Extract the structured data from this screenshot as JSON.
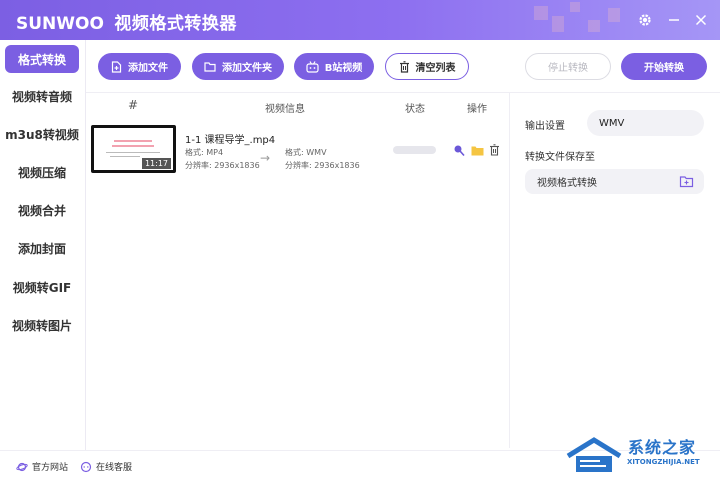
{
  "app": {
    "brand": "SUNWOO",
    "title": "视频格式转换器"
  },
  "colors": {
    "accent": "#7b5fe2",
    "sidebar_active_bg": "#7b5fe2",
    "watermark_blue": "#2a74c9"
  },
  "titlebar_icons": [
    "gear-icon",
    "minimize-icon",
    "close-icon"
  ],
  "sidebar": {
    "active_index": 0,
    "items": [
      {
        "label": "格式转换"
      },
      {
        "label": "视频转音频"
      },
      {
        "label": "m3u8转视频"
      },
      {
        "label": "视频压缩"
      },
      {
        "label": "视频合并"
      },
      {
        "label": "添加封面"
      },
      {
        "label": "视频转GIF"
      },
      {
        "label": "视频转图片"
      }
    ]
  },
  "toolbar": {
    "add_file": "添加文件",
    "add_folder": "添加文件夹",
    "bilibili": "B站视频",
    "clear_list": "清空列表",
    "stop": "停止转换",
    "start": "开始转换"
  },
  "table": {
    "headers": {
      "index": "#",
      "info": "视频信息",
      "status": "状态",
      "action": "操作"
    },
    "rows": [
      {
        "filename": "1-1 课程导学_.mp4",
        "duration": "11:17",
        "source_format_label": "格式:",
        "source_format": "MP4",
        "source_resolution_label": "分辨率:",
        "source_resolution": "2936x1836",
        "target_format_label": "格式:",
        "target_format": "WMV",
        "target_resolution_label": "分辨率:",
        "target_resolution": "2936x1836",
        "progress": 0,
        "action_icons": [
          "pin-icon",
          "folder-icon",
          "trash-icon"
        ]
      }
    ]
  },
  "right_panel": {
    "output_label": "输出设置",
    "output_format": "WMV",
    "save_label": "转换文件保存至",
    "save_path": "视频格式转换"
  },
  "footer": {
    "website": "官方网站",
    "support": "在线客服"
  },
  "watermark": {
    "title": "系统之家",
    "url": "XITONGZHIJIA.NET"
  }
}
